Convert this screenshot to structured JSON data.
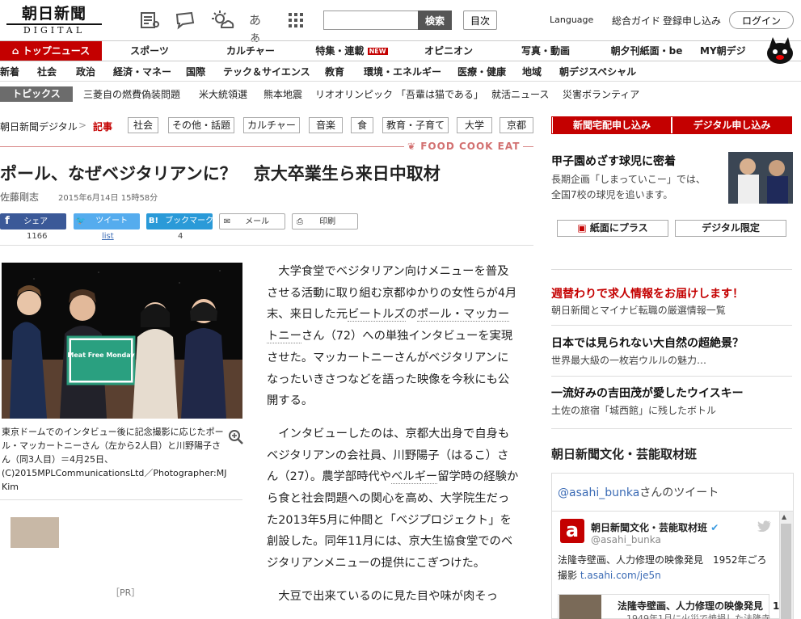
{
  "header": {
    "logo_top": "朝日新聞",
    "logo_bottom": "DIGITAL",
    "font_size_label": "あぁ",
    "search_placeholder": "",
    "search_button": "検索",
    "index_button": "目次",
    "language": "Language",
    "guide": "総合ガイド",
    "signup": "登録申し込み",
    "login": "ログイン"
  },
  "main_nav": [
    {
      "label": "トップニュース"
    },
    {
      "label": "スポーツ"
    },
    {
      "label": "カルチャー"
    },
    {
      "label": "特集・連載"
    },
    {
      "label": "オピニオン"
    },
    {
      "label": "写真・動画"
    },
    {
      "label": "朝夕刊紙面・be"
    },
    {
      "label": "MY朝デジ"
    }
  ],
  "new_badge": "NEW",
  "sub_nav": [
    "新着",
    "社会",
    "政治",
    "経済・マネー",
    "国際",
    "テック＆サイエンス",
    "教育",
    "環境・エネルギー",
    "医療・健康",
    "地域",
    "朝デジスペシャル"
  ],
  "topics": {
    "label": "トピックス",
    "items": [
      "三菱自の燃費偽装問題",
      "米大統領選",
      "熊本地震",
      "リオオリンピック",
      "「吾輩は猫である」",
      "就活ニュース",
      "災害ボランティア"
    ]
  },
  "breadcrumb": {
    "home": "朝日新聞デジタル",
    "separator": ">",
    "current": "記事"
  },
  "tags": [
    "社会",
    "その他・話題",
    "カルチャー",
    "音楽",
    "食",
    "教育・子育て",
    "大学",
    "京都"
  ],
  "section_label": "FOOD COOK EAT",
  "article": {
    "title": "ポール、なぜベジタリアンに？　京大卒業生ら来日中取材",
    "author": "佐藤剛志",
    "date": "2015年6月14日 15時58分",
    "share": [
      {
        "label": "シェア",
        "count": "1166",
        "color": "#3b5998"
      },
      {
        "label": "ツイート",
        "count": "list",
        "color": "#55acee"
      },
      {
        "label": "ブックマーク",
        "count": "4",
        "color": "#2a9ad8"
      },
      {
        "label": "メール",
        "count": ""
      },
      {
        "label": "印刷",
        "count": ""
      }
    ],
    "photo_sign": "Meat Free Monday",
    "caption": "東京ドームでのインタビュー後に記念撮影に応じたポール・マッカートニーさん（左から2人目）と川野陽子さん（同3人目）＝4月25日、(C)2015MPLCommunicationsLtd／Photographer:MJ Kim",
    "paragraphs": [
      {
        "before": "大学食堂でベジタリアン向けメニューを普及させる活動に取り組む京都ゆかりの女性らが4月末、来日した元",
        "link1": "ビートルズ",
        "mid": "の",
        "link2": "ポール・マッカートニー",
        "after": "さん（72）への単独インタビューを実現させた。マッカートニーさんがベジタリアンになったいきさつなどを語った映像を今秋にも公開する。"
      },
      {
        "before": "インタビューしたのは、京都大出身で自身もベジタリアンの会社員、川野陽子（はるこ）さん（27）。農学部時代や",
        "link1": "ベルギー",
        "after": "留学時の経験から食と社会問題への関心を高め、大学院生だった2013年5月に仲間と「ベジプロジェクト」を創設した。同年11月には、京大生協食堂でのベジタリアンメニューの提供にこぎつけた。"
      },
      {
        "before": "大豆で出来ているのに見た目や味が肉そっ"
      }
    ],
    "pr_label": "［PR］"
  },
  "sidebar": {
    "subscribe_paper": "新聞宅配申し込み",
    "subscribe_digital": "デジタル申し込み",
    "promo_title": "甲子園めざす球児に密着",
    "promo_desc": "長期企画「しまっていこー」では、全国7校の球児を追います。",
    "plus_button": "紙面にプラス",
    "digital_only": "デジタル限定",
    "ads": [
      {
        "title": "週替わりで求人情報をお届けします！",
        "desc": "朝日新聞とマイナビ転職の厳選情報一覧"
      },
      {
        "title": "日本では見られない大自然の超絶景？",
        "desc": "世界最大級の一枚岩ウルルの魅力…"
      },
      {
        "title": "一流好みの吉田茂が愛したウイスキー",
        "desc": "土佐の旅宿「城西館」に残したボトル"
      }
    ],
    "culture_title": "朝日新聞文化・芸能取材班",
    "twitter": {
      "header_handle": "@asahi_bunka",
      "header_suffix": "さんのツイート",
      "avatar_letter": "a",
      "name": "朝日新聞文化・芸能取材班",
      "handle": "@asahi_bunka",
      "text": "法隆寺壁画、人力修理の映像発見　1952年ごろ撮影",
      "link": "t.asahi.com/je5n",
      "card_title": "法隆寺壁画、人力修理の映像発見　1...",
      "card_sub": "1949年1月に火災で焼損した法隆寺"
    }
  },
  "colors": {
    "accent": "#c40000",
    "link": "#3b6bb5"
  }
}
